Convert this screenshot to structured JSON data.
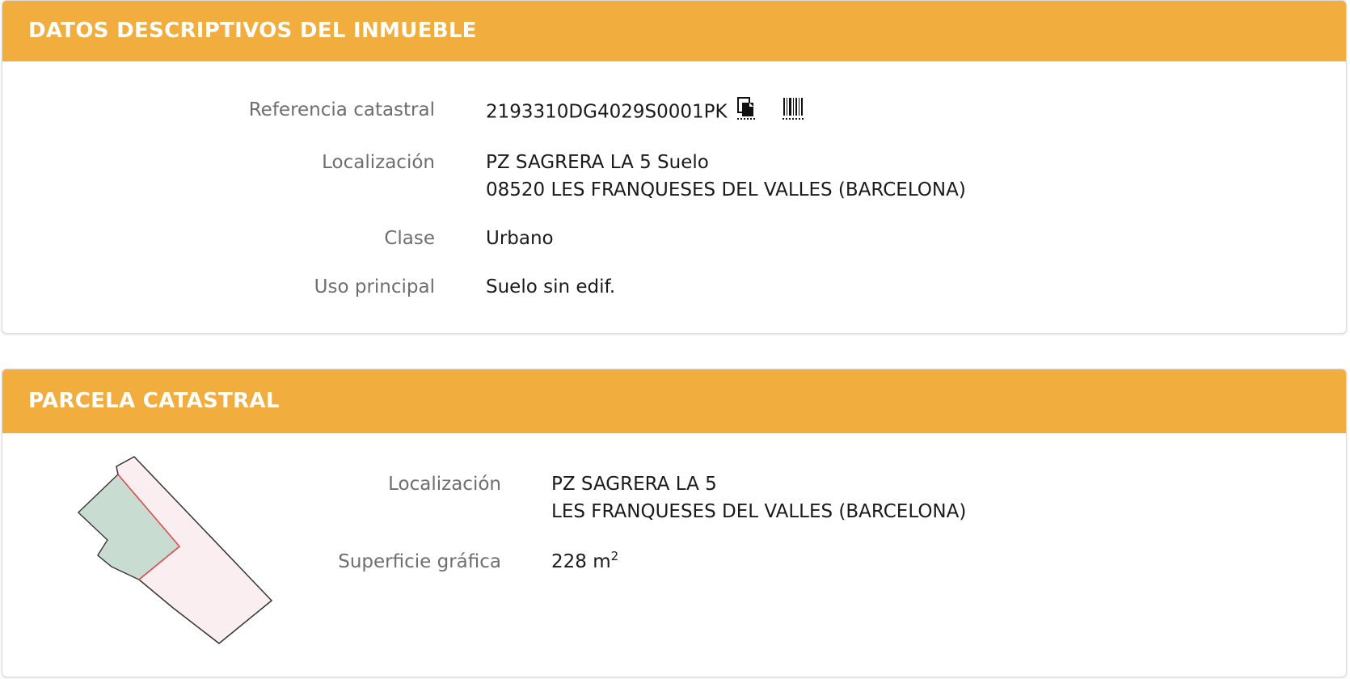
{
  "datos": {
    "title": "DATOS DESCRIPTIVOS DEL INMUEBLE",
    "referencia_label": "Referencia catastral",
    "referencia_value": "2193310DG4029S0001PK",
    "localizacion_label": "Localización",
    "localizacion_line1": "PZ SAGRERA LA 5 Suelo",
    "localizacion_line2": "08520 LES FRANQUESES DEL VALLES (BARCELONA)",
    "clase_label": "Clase",
    "clase_value": "Urbano",
    "uso_label": "Uso principal",
    "uso_value": "Suelo sin edif.",
    "icons": [
      "copy-document-icon",
      "barcode-icon"
    ]
  },
  "parcela": {
    "title": "PARCELA CATASTRAL",
    "localizacion_label": "Localización",
    "localizacion_line1": "PZ SAGRERA LA 5",
    "localizacion_line2": "LES FRANQUESES DEL VALLES (BARCELONA)",
    "superficie_label": "Superficie gráfica",
    "superficie_value": "228 m",
    "superficie_exp": "2"
  },
  "colors": {
    "header_bg": "#f2ad3f",
    "header_text": "#ffffff",
    "label_text": "#6e6e6e",
    "value_text": "#1a1a1a",
    "parcel_fill": "#fbeef0",
    "building_fill": "#c8dcd2",
    "boundary_red": "#e24a4a"
  }
}
